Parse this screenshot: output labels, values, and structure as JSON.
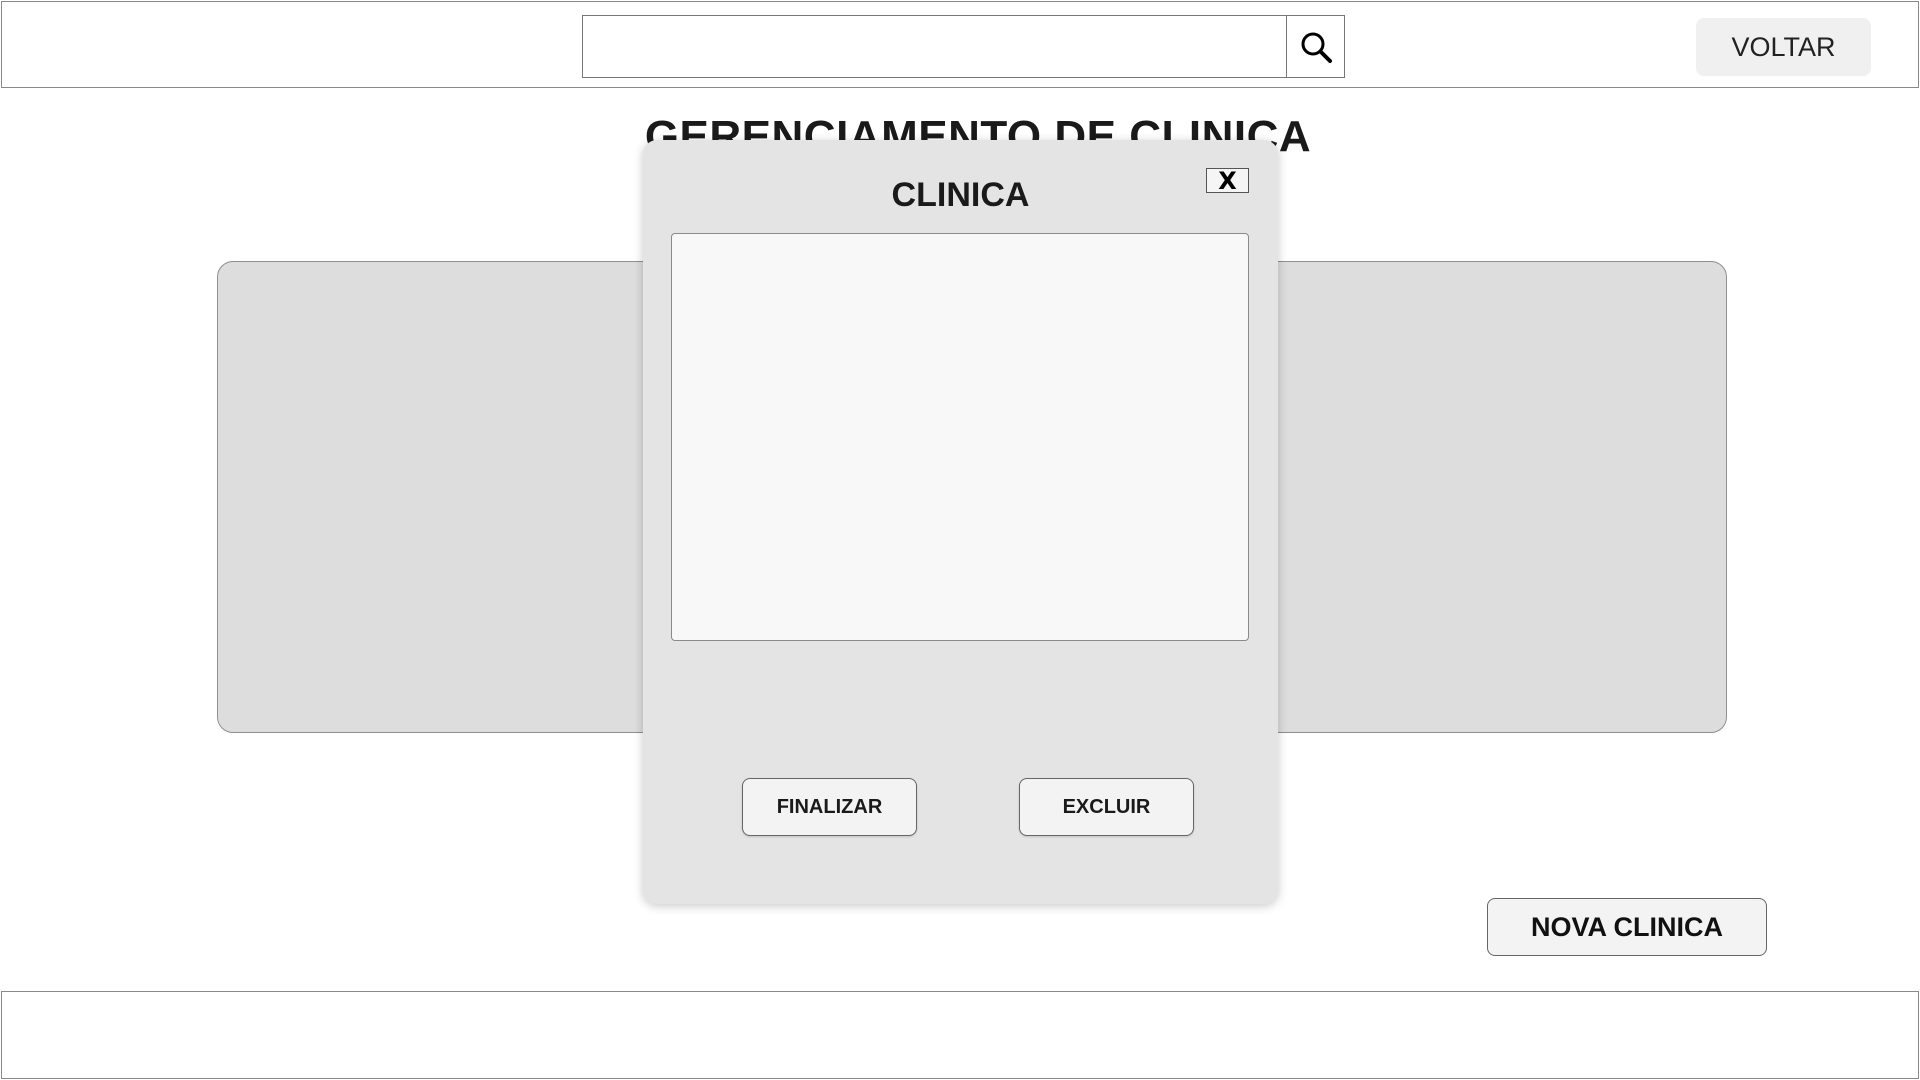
{
  "header": {
    "search": {
      "value": "",
      "placeholder": "",
      "icon": "search-icon"
    },
    "back_label": "VOLTAR"
  },
  "page": {
    "title": "GERENCIAMENTO DE CLINICA"
  },
  "actions": {
    "new_clinic_label": "NOVA CLINICA"
  },
  "modal": {
    "title": "CLINICA",
    "close_label": "X",
    "finalize_label": "FINALIZAR",
    "delete_label": "EXCLUIR"
  },
  "colors": {
    "panel": "#dddddd",
    "modal": "#e4e4e4",
    "button": "#f3f3f3",
    "border": "#8a8a8a"
  }
}
